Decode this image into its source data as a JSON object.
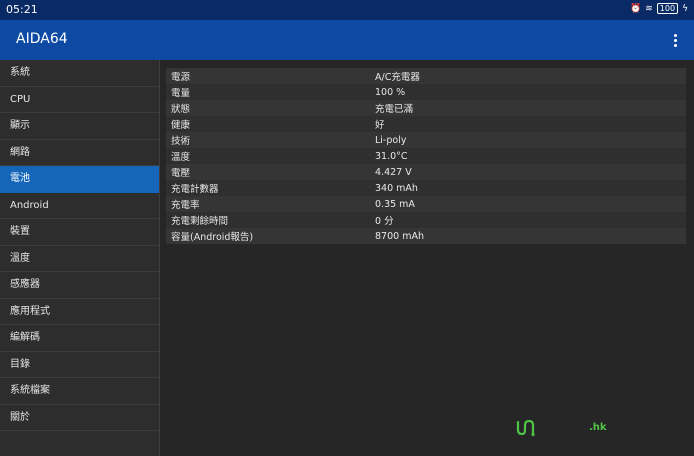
{
  "status": {
    "time": "05:21",
    "battery": "100"
  },
  "app": {
    "title": "AIDA64"
  },
  "sidebar": {
    "items": [
      {
        "label": "系統"
      },
      {
        "label": "CPU"
      },
      {
        "label": "顯示"
      },
      {
        "label": "網路"
      },
      {
        "label": "電池"
      },
      {
        "label": "Android"
      },
      {
        "label": "裝置"
      },
      {
        "label": "溫度"
      },
      {
        "label": "感應器"
      },
      {
        "label": "應用程式"
      },
      {
        "label": "編解碼"
      },
      {
        "label": "目錄"
      },
      {
        "label": "系統檔案"
      },
      {
        "label": "關於"
      }
    ],
    "active_index": 4
  },
  "battery_info": [
    {
      "key": "電源",
      "value": "A/C充電器"
    },
    {
      "key": "電量",
      "value": "100 %"
    },
    {
      "key": "狀態",
      "value": "充電已滿"
    },
    {
      "key": "健康",
      "value": "好"
    },
    {
      "key": "技術",
      "value": "Li-poly"
    },
    {
      "key": "溫度",
      "value": "31.0°C"
    },
    {
      "key": "電壓",
      "value": "4.427 V"
    },
    {
      "key": "充電計數器",
      "value": "340 mAh"
    },
    {
      "key": "充電率",
      "value": "0.35 mA"
    },
    {
      "key": "充電剩餘時間",
      "value": "0 分"
    },
    {
      "key": "容量(Android報告)",
      "value": "8700 mAh"
    }
  ],
  "watermark": {
    "text": ".hk"
  },
  "colors": {
    "statusbar": "#0a2a66",
    "appbar": "#0e4aa3",
    "active": "#1566b8",
    "background": "#262626"
  }
}
